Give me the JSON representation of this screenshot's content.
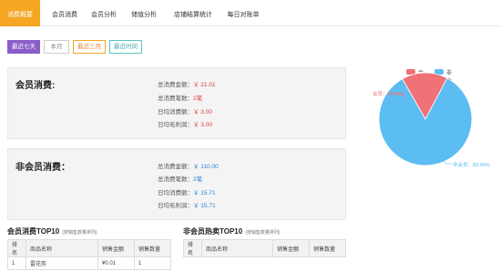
{
  "tabs": [
    {
      "label": "消费概要",
      "active": true
    },
    {
      "label": "会员消费",
      "active": false
    },
    {
      "label": "会员分析",
      "active": false
    },
    {
      "label": "储值分析",
      "active": false
    },
    {
      "label": "店铺结算统计",
      "active": false
    },
    {
      "label": "每日对账单",
      "active": false
    }
  ],
  "filters": [
    {
      "label": "最近七天",
      "state": "active"
    },
    {
      "label": "本月",
      "state": "default"
    },
    {
      "label": "最近三月",
      "state": "orange"
    },
    {
      "label": "最近时间",
      "state": "teal"
    }
  ],
  "member_card": {
    "title": "会员消费:",
    "rows": [
      {
        "label": "总消费金额：",
        "value": "￥ 21.01"
      },
      {
        "label": "总消费笔数：",
        "value": "2笔"
      },
      {
        "label": "日均消费额：",
        "value": "￥ 3.00"
      },
      {
        "label": "日均毛利润：",
        "value": "￥ 3.00"
      }
    ]
  },
  "nonmember_card": {
    "title": "非会员消费：",
    "rows": [
      {
        "label": "总消费金额：",
        "value": "￥ 110.00"
      },
      {
        "label": "总消费笔数：",
        "value": "2笔"
      },
      {
        "label": "日均消费额：",
        "value": "￥ 15.71"
      },
      {
        "label": "日均毛利润：",
        "value": "￥ 15.71"
      }
    ]
  },
  "pie": {
    "legend": [
      {
        "label": "会员",
        "color": "#f07177"
      },
      {
        "label": "非会员",
        "color": "#5bbdf2"
      }
    ],
    "slices": [
      {
        "name": "会员",
        "percent": 16.04,
        "color": "#f07177",
        "label": "会员：16.04%"
      },
      {
        "name": "非会员",
        "percent": 83.96,
        "color": "#5bbdf2",
        "label": "非会员：83.96%"
      }
    ]
  },
  "member_top": {
    "title": "会员消费TOP10",
    "subtitle": "(按销售数量排列)",
    "headers": [
      "排名",
      "商品名称",
      "销售金额",
      "销售数量"
    ],
    "rows": [
      [
        "1",
        "雷花剪",
        "¥0.01",
        "1"
      ]
    ]
  },
  "nonmember_top": {
    "title": "非会员热卖TOP10",
    "subtitle": "(按销售数量排列)",
    "headers": [
      "排名",
      "商品名称",
      "销售金额",
      "销售数量"
    ],
    "rows": []
  }
}
